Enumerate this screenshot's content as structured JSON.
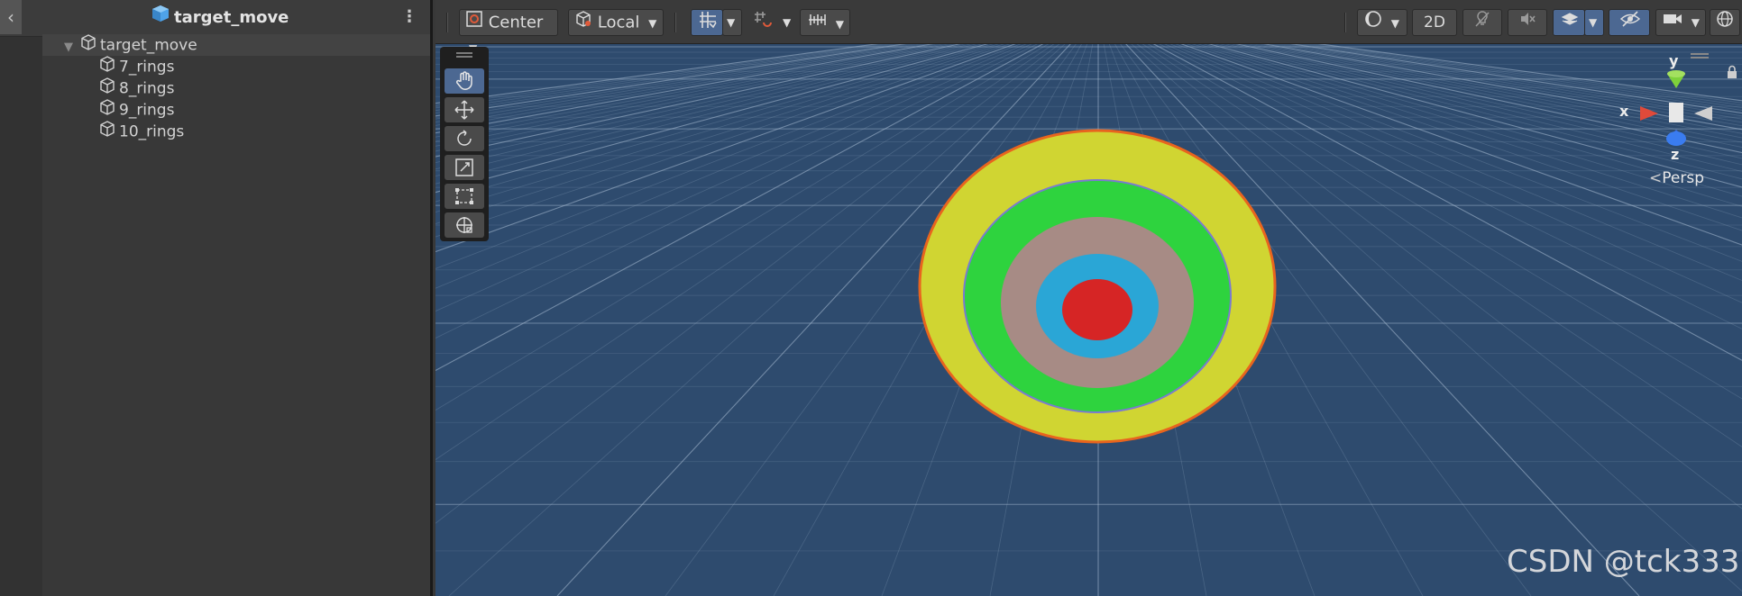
{
  "hierarchy": {
    "back_icon": "chevron-left-icon",
    "title": "target_move",
    "menu_icon": "kebab-menu-icon",
    "items": [
      {
        "label": "target_move",
        "expanded": true
      },
      {
        "label": "7_rings"
      },
      {
        "label": "8_rings"
      },
      {
        "label": "9_rings"
      },
      {
        "label": "10_rings"
      }
    ]
  },
  "scene": {
    "toolbar": {
      "pivot_mode": "Center",
      "pivot_rotation": "Local",
      "view_2d": "2D"
    },
    "tools": [
      "hand-tool",
      "move-tool",
      "rotate-tool",
      "scale-tool",
      "rect-tool",
      "transform-tool"
    ],
    "gizmo": {
      "y": "y",
      "x": "x",
      "z": "z",
      "projection": "Persp"
    },
    "target_colors": {
      "outer": "#d0d532",
      "ring2": "#2ed33e",
      "ring3": "#a78b85",
      "ring4": "#2aa6d6",
      "bullseye": "#d62525"
    },
    "watermark": "CSDN @tck333"
  }
}
